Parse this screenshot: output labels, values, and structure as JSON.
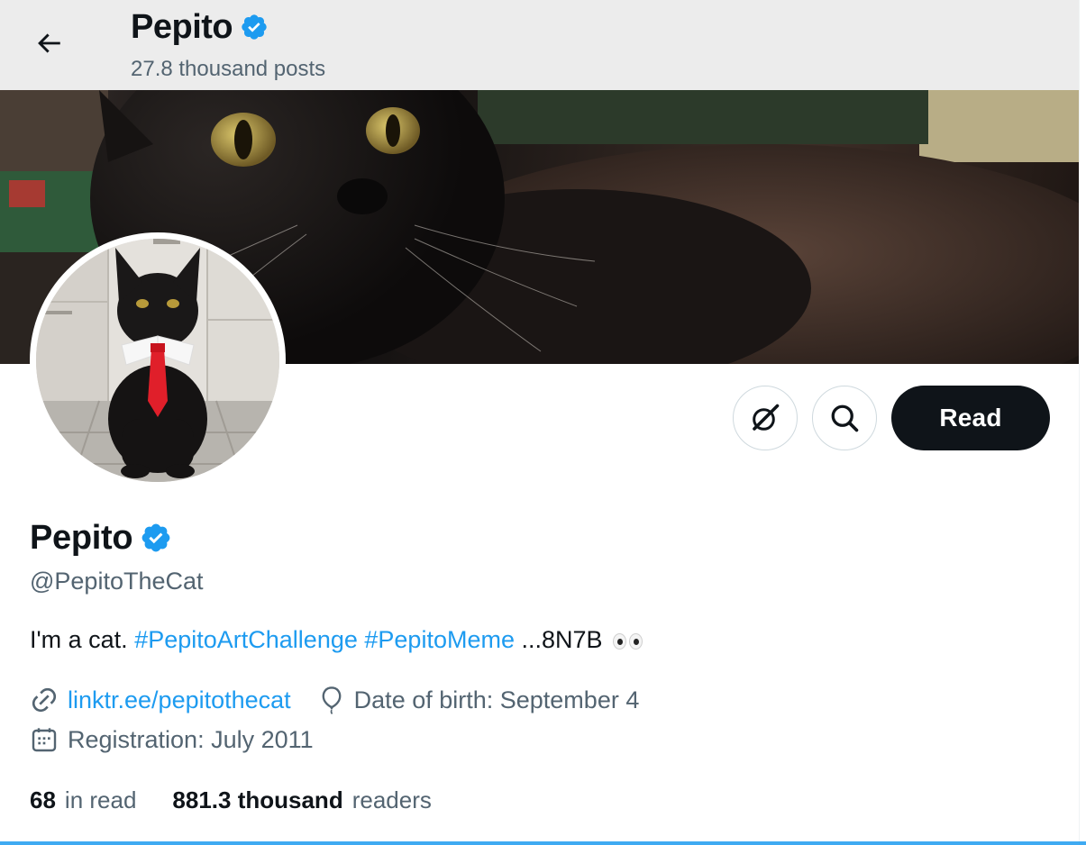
{
  "header": {
    "name": "Pepito",
    "posts_count": "27.8 thousand posts"
  },
  "profile": {
    "name": "Pepito",
    "handle": "@PepitoTheCat",
    "bio": {
      "text_start": "I'm a cat.",
      "hashtag_1": "#PepitoArtChallenge",
      "hashtag_2": "#PepitoMeme",
      "text_end": "...8N7B"
    },
    "website": "linktr.ee/pepitothecat",
    "birth_date": "Date of birth: September 4",
    "registration": "Registration: July 2011"
  },
  "stats": {
    "following_count": "68",
    "following_label": "in read",
    "followers_count": "881.3 thousand",
    "followers_label": "readers"
  },
  "actions": {
    "follow_label": "Read"
  },
  "colors": {
    "accent": "#1d9bf0",
    "text": "#0f1419",
    "secondary_text": "#536471",
    "button_dark": "#0f1419"
  },
  "icons": {
    "back": "arrow-left-icon",
    "verified": "verified-badge-icon",
    "grok": "grok-icon",
    "search": "search-icon",
    "link": "link-icon",
    "birthday": "balloon-icon",
    "calendar": "calendar-icon",
    "eyes": "eyes-emoji"
  }
}
